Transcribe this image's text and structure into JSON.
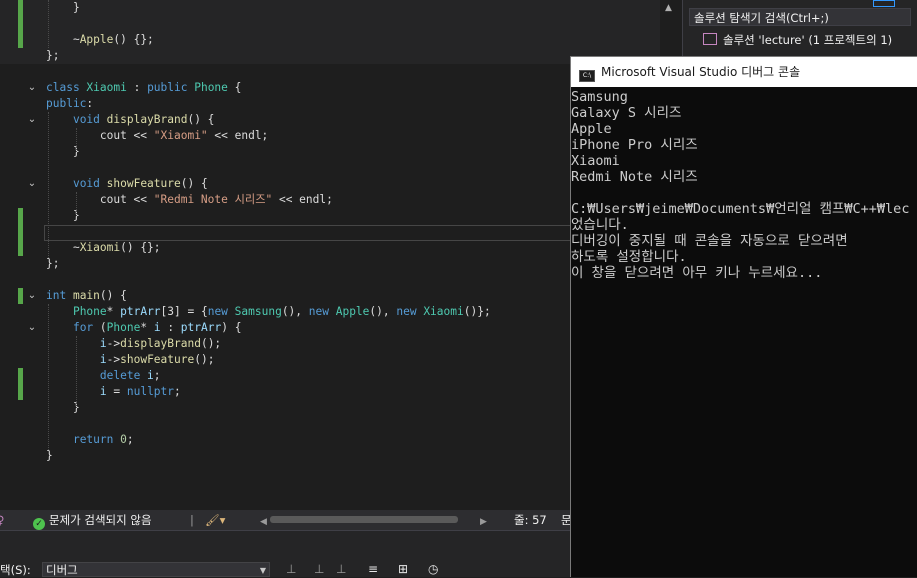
{
  "editor": {
    "lines": [
      {
        "indent": 0,
        "html": "    }",
        "tokens": [
          {
            "t": "    }",
            "c": ""
          }
        ]
      },
      {
        "tokens": []
      },
      {
        "tokens": [
          {
            "t": "    ~",
            "c": ""
          },
          {
            "t": "Apple",
            "c": "fn"
          },
          {
            "t": "() {};",
            "c": ""
          }
        ]
      },
      {
        "tokens": [
          {
            "t": "};",
            "c": ""
          }
        ]
      },
      {
        "tokens": []
      },
      {
        "tokens": [
          {
            "t": "class ",
            "c": "kw"
          },
          {
            "t": "Xiaomi",
            "c": "ty"
          },
          {
            "t": " : ",
            "c": ""
          },
          {
            "t": "public ",
            "c": "kw"
          },
          {
            "t": "Phone",
            "c": "ty"
          },
          {
            "t": " {",
            "c": ""
          }
        ]
      },
      {
        "tokens": [
          {
            "t": "public",
            "c": "kw"
          },
          {
            "t": ":",
            "c": ""
          }
        ]
      },
      {
        "tokens": [
          {
            "t": "    ",
            "c": ""
          },
          {
            "t": "void ",
            "c": "kw"
          },
          {
            "t": "displayBrand",
            "c": "fn"
          },
          {
            "t": "() {",
            "c": ""
          }
        ]
      },
      {
        "tokens": [
          {
            "t": "        cout << ",
            "c": ""
          },
          {
            "t": "\"Xiaomi\"",
            "c": "st"
          },
          {
            "t": " << endl;",
            "c": ""
          }
        ]
      },
      {
        "tokens": [
          {
            "t": "    }",
            "c": ""
          }
        ]
      },
      {
        "tokens": []
      },
      {
        "tokens": [
          {
            "t": "    ",
            "c": ""
          },
          {
            "t": "void ",
            "c": "kw"
          },
          {
            "t": "showFeature",
            "c": "fn"
          },
          {
            "t": "() {",
            "c": ""
          }
        ]
      },
      {
        "tokens": [
          {
            "t": "        cout << ",
            "c": ""
          },
          {
            "t": "\"Redmi Note 시리즈\"",
            "c": "st"
          },
          {
            "t": " << endl;",
            "c": ""
          }
        ]
      },
      {
        "tokens": [
          {
            "t": "    }",
            "c": ""
          }
        ]
      },
      {
        "tokens": []
      },
      {
        "tokens": [
          {
            "t": "    ~",
            "c": ""
          },
          {
            "t": "Xiaomi",
            "c": "fn"
          },
          {
            "t": "() {};",
            "c": ""
          }
        ]
      },
      {
        "tokens": [
          {
            "t": "};",
            "c": ""
          }
        ]
      },
      {
        "tokens": []
      },
      {
        "tokens": [
          {
            "t": "int ",
            "c": "kw"
          },
          {
            "t": "main",
            "c": "fn"
          },
          {
            "t": "() {",
            "c": ""
          }
        ]
      },
      {
        "tokens": [
          {
            "t": "    ",
            "c": ""
          },
          {
            "t": "Phone",
            "c": "ty"
          },
          {
            "t": "* ",
            "c": ""
          },
          {
            "t": "ptrArr",
            "c": "va"
          },
          {
            "t": "[3] = {",
            "c": ""
          },
          {
            "t": "new ",
            "c": "kw"
          },
          {
            "t": "Samsung",
            "c": "ty"
          },
          {
            "t": "(), ",
            "c": ""
          },
          {
            "t": "new ",
            "c": "kw"
          },
          {
            "t": "Apple",
            "c": "ty"
          },
          {
            "t": "(), ",
            "c": ""
          },
          {
            "t": "new ",
            "c": "kw"
          },
          {
            "t": "Xiaomi",
            "c": "ty"
          },
          {
            "t": "()};",
            "c": ""
          }
        ]
      },
      {
        "tokens": [
          {
            "t": "    ",
            "c": ""
          },
          {
            "t": "for ",
            "c": "kw"
          },
          {
            "t": "(",
            "c": ""
          },
          {
            "t": "Phone",
            "c": "ty"
          },
          {
            "t": "* ",
            "c": ""
          },
          {
            "t": "i",
            "c": "va"
          },
          {
            "t": " : ",
            "c": ""
          },
          {
            "t": "ptrArr",
            "c": "va"
          },
          {
            "t": ") {",
            "c": ""
          }
        ]
      },
      {
        "tokens": [
          {
            "t": "        ",
            "c": ""
          },
          {
            "t": "i",
            "c": "va"
          },
          {
            "t": "->",
            "c": ""
          },
          {
            "t": "displayBrand",
            "c": "fn"
          },
          {
            "t": "();",
            "c": ""
          }
        ]
      },
      {
        "tokens": [
          {
            "t": "        ",
            "c": ""
          },
          {
            "t": "i",
            "c": "va"
          },
          {
            "t": "->",
            "c": ""
          },
          {
            "t": "showFeature",
            "c": "fn"
          },
          {
            "t": "();",
            "c": ""
          }
        ]
      },
      {
        "tokens": [
          {
            "t": "        ",
            "c": ""
          },
          {
            "t": "delete ",
            "c": "kw"
          },
          {
            "t": "i",
            "c": "va"
          },
          {
            "t": ";",
            "c": ""
          }
        ]
      },
      {
        "tokens": [
          {
            "t": "        ",
            "c": ""
          },
          {
            "t": "i",
            "c": "va"
          },
          {
            "t": " = ",
            "c": ""
          },
          {
            "t": "nullptr",
            "c": "kw"
          },
          {
            "t": ";",
            "c": ""
          }
        ]
      },
      {
        "tokens": [
          {
            "t": "    }",
            "c": ""
          }
        ]
      },
      {
        "tokens": []
      },
      {
        "tokens": [
          {
            "t": "    ",
            "c": ""
          },
          {
            "t": "return ",
            "c": "kw"
          },
          {
            "t": "0",
            "c": "nm"
          },
          {
            "t": ";",
            "c": ""
          }
        ]
      },
      {
        "tokens": [
          {
            "t": "}",
            "c": ""
          }
        ]
      }
    ]
  },
  "statusbar": {
    "issues": "문제가 검색되지 않음",
    "line_label": "줄: 57",
    "col_label": "문"
  },
  "bottom_panel": {
    "select_label": "택(S):",
    "select_value": "디버그"
  },
  "solution_explorer": {
    "search_placeholder": "솔루션 탐색기 검색(Ctrl+;)",
    "root_item": "솔루션 'lecture' (1 프로젝트의 1)"
  },
  "console": {
    "title": "Microsoft Visual Studio 디버그 콘솔",
    "lines": [
      "Samsung",
      "Galaxy S 시리즈",
      "Apple",
      "iPhone Pro 시리즈",
      "Xiaomi",
      "Redmi Note 시리즈",
      "",
      "C:₩Users₩jeime₩Documents₩언리얼 캠프₩C++₩lec",
      "었습니다.",
      "디버깅이 중지될 때 콘솔을 자동으로 닫으려면",
      "하도록 설정합니다.",
      "이 창을 닫으려면 아무 키나 누르세요..."
    ]
  },
  "colors": {
    "editor_bg": "#1e1e1e",
    "keyword": "#569cd6",
    "type": "#4ec9b0",
    "string": "#d69d85",
    "change_bar": "#57a64a"
  }
}
